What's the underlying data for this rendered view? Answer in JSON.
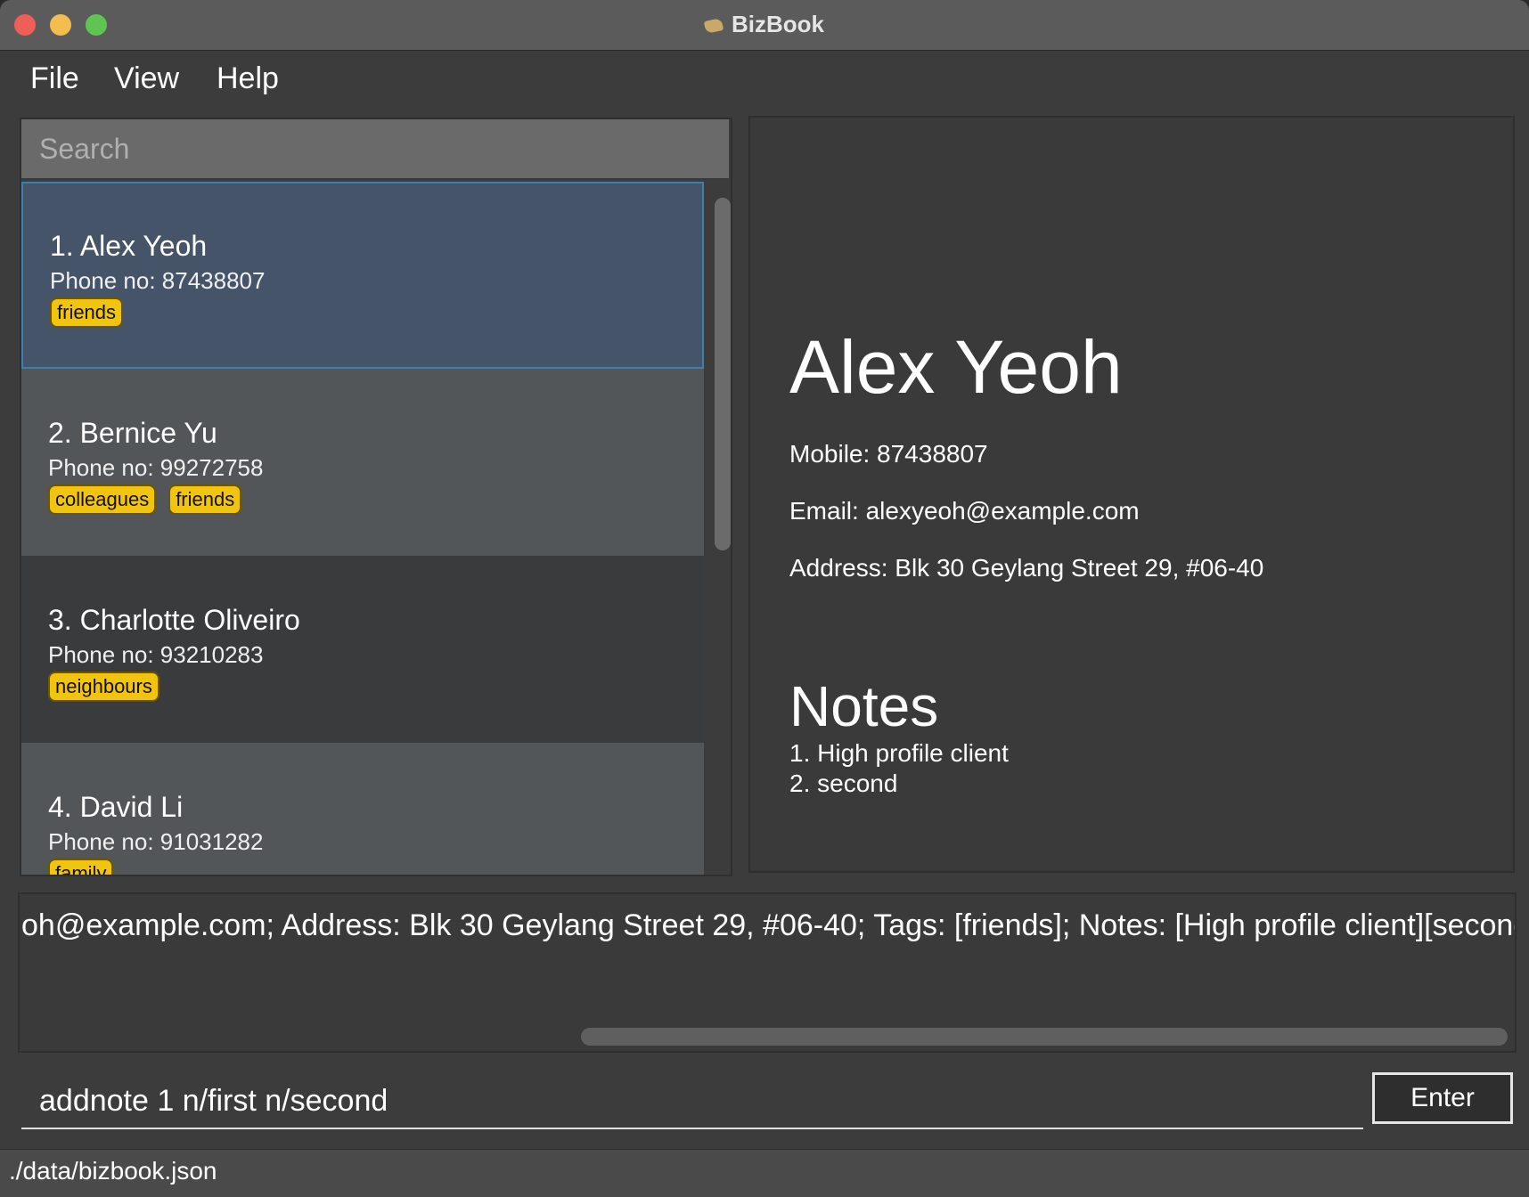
{
  "window": {
    "title": "BizBook"
  },
  "menu": {
    "file": "File",
    "view": "View",
    "help": "Help"
  },
  "search": {
    "placeholder": "Search"
  },
  "persons": [
    {
      "name": "1. Alex Yeoh",
      "phone": "Phone no: 87438807",
      "tags": [
        "friends"
      ]
    },
    {
      "name": "2. Bernice Yu",
      "phone": "Phone no: 99272758",
      "tags": [
        "colleagues",
        "friends"
      ]
    },
    {
      "name": "3. Charlotte Oliveiro",
      "phone": "Phone no: 93210283",
      "tags": [
        "neighbours"
      ]
    },
    {
      "name": "4. David Li",
      "phone": "Phone no: 91031282",
      "tags": [
        "family"
      ]
    }
  ],
  "detail": {
    "name": "Alex Yeoh",
    "mobile": "Mobile: 87438807",
    "email": "Email: alexyeoh@example.com",
    "address": "Address: Blk 30 Geylang Street 29, #06-40",
    "notes_title": "Notes",
    "notes": [
      "1. High profile client",
      "2. second"
    ]
  },
  "result": {
    "text": "oh@example.com; Address: Blk 30 Geylang Street 29, #06-40; Tags: [friends]; Notes: [High profile client][second]"
  },
  "command": {
    "value": "addnote 1 n/first n/second",
    "enter_label": "Enter"
  },
  "status": {
    "path": "./data/bizbook.json"
  },
  "colors": {
    "tag": "#f1c40f",
    "selected_card": "#46546a",
    "selected_border": "#3c7fb1"
  }
}
